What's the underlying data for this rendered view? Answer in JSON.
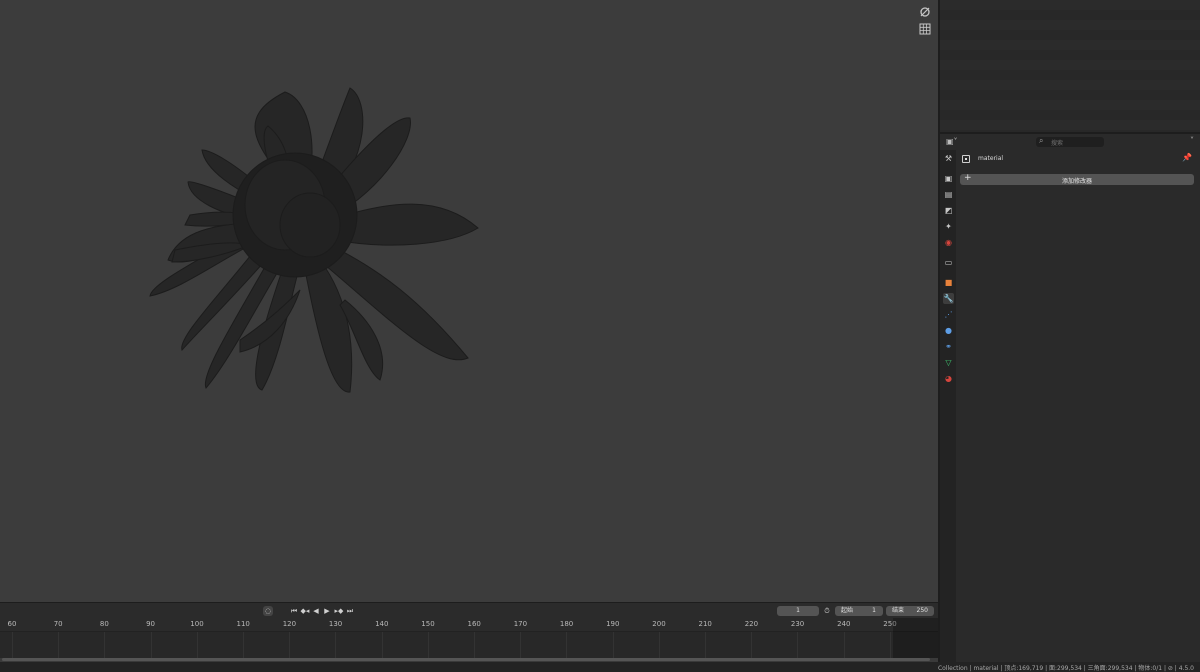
{
  "viewport": {
    "nav_icons": [
      "camera-icon",
      "grid-icon"
    ]
  },
  "properties": {
    "header": {
      "editor_icon": "properties-editor-icon",
      "search_placeholder": "搜索"
    },
    "object_name": "material",
    "add_modifier_label": "添加修改器",
    "tabs": [
      {
        "name": "tool-tab-icon",
        "glyph": "⚒",
        "color": "#c8c8c8"
      },
      {
        "name": "render-tab-icon",
        "glyph": "▣",
        "color": "#c8c8c8"
      },
      {
        "name": "output-tab-icon",
        "glyph": "▤",
        "color": "#c8c8c8"
      },
      {
        "name": "view-layer-tab-icon",
        "glyph": "◩",
        "color": "#c8c8c8"
      },
      {
        "name": "scene-tab-icon",
        "glyph": "✦",
        "color": "#c8c8c8"
      },
      {
        "name": "world-tab-icon",
        "glyph": "◉",
        "color": "#d6453d"
      },
      {
        "name": "collection-tab-icon",
        "glyph": "▭",
        "color": "#c8c8c8"
      },
      {
        "name": "object-tab-icon",
        "glyph": "■",
        "color": "#e8823b"
      },
      {
        "name": "modifier-tab-icon",
        "glyph": "🔧",
        "color": "#5e9ee6"
      },
      {
        "name": "particles-tab-icon",
        "glyph": "⋰",
        "color": "#5e9ee6"
      },
      {
        "name": "physics-tab-icon",
        "glyph": "●",
        "color": "#5e9ee6"
      },
      {
        "name": "constraints-tab-icon",
        "glyph": "⚭",
        "color": "#5e9ee6"
      },
      {
        "name": "data-tab-icon",
        "glyph": "▽",
        "color": "#3fc46f"
      },
      {
        "name": "material-tab-icon",
        "glyph": "◕",
        "color": "#d6453d"
      }
    ]
  },
  "timeline": {
    "current_frame": "1",
    "start_label": "起始",
    "start_value": "1",
    "end_label": "结束",
    "end_value": "250",
    "ticks": [
      "60",
      "70",
      "80",
      "90",
      "100",
      "110",
      "120",
      "130",
      "140",
      "150",
      "160",
      "170",
      "180",
      "190",
      "200",
      "210",
      "220",
      "230",
      "240",
      "250"
    ]
  },
  "statusbar": {
    "text": "Collection | material | 顶点:169,719 | 面:299,534 | 三角面:299,534 | 物体:0/1 |  ⊘ | 4.5.0"
  }
}
